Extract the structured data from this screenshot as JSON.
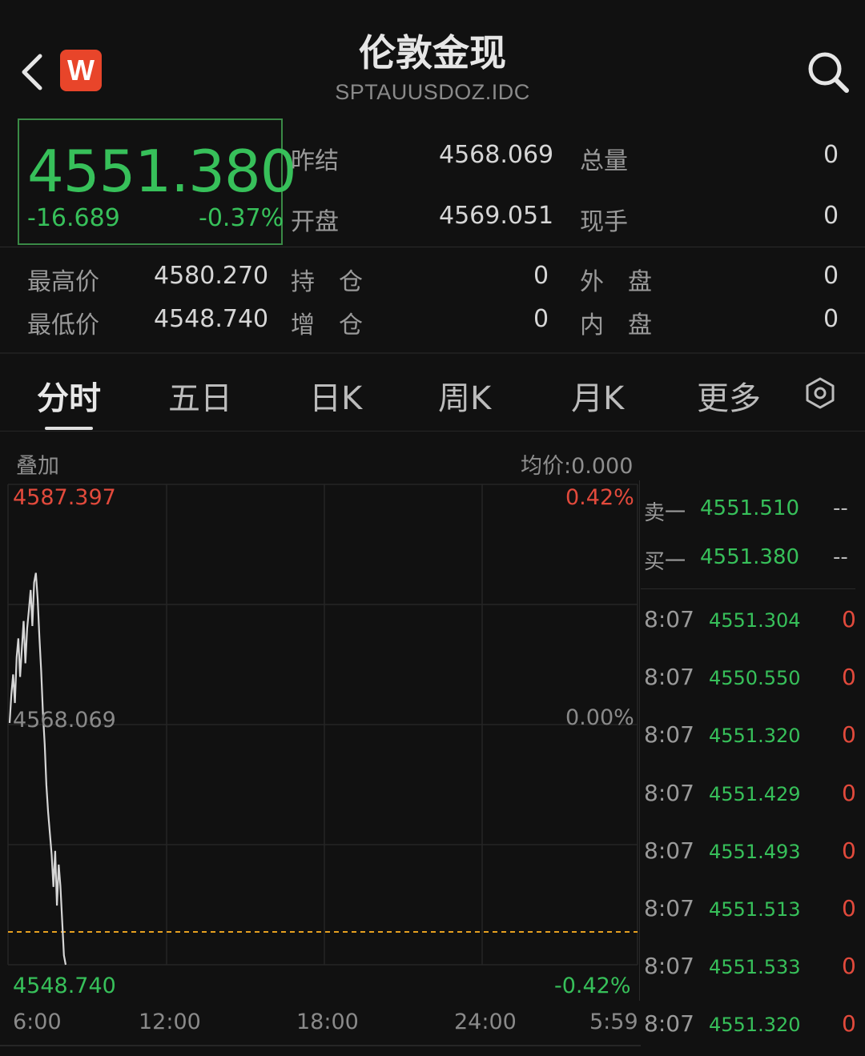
{
  "header": {
    "title": "伦敦金现",
    "code": "SPTAUUSDOZ.IDC",
    "logo_letter": "W"
  },
  "quote": {
    "price": "4551.380",
    "change": "-16.689",
    "change_pct": "-0.37%",
    "prev_settle_label": "昨结",
    "prev_settle": "4568.069",
    "open_label": "开盘",
    "open": "4569.051",
    "total_vol_label": "总量",
    "total_vol": "0",
    "cur_hand_label": "现手",
    "cur_hand": "0",
    "high_label": "最高价",
    "high": "4580.270",
    "low_label": "最低价",
    "low": "4548.740",
    "hold_label": "持　仓",
    "hold": "0",
    "add_label": "增　仓",
    "add": "0",
    "outer_label": "外　盘",
    "outer": "0",
    "inner_label": "内　盘",
    "inner": "0"
  },
  "tabs": [
    "分时",
    "五日",
    "日K",
    "周K",
    "月K",
    "更多"
  ],
  "chart_meta": {
    "overlay_label": "叠加",
    "avg_label": "均价:0.000"
  },
  "chart_data": {
    "type": "line",
    "y_top": "4587.397",
    "y_mid": "4568.069",
    "y_bottom": "4548.740",
    "pct_top": "0.42%",
    "pct_mid": "0.00%",
    "pct_bottom": "-0.42%",
    "ylim": [
      4548.74,
      4587.397
    ],
    "x_ticks": [
      "6:00",
      "12:00",
      "18:00",
      "24:00",
      "5:59"
    ],
    "prev_close": 4568.069,
    "low_marker": 4551.38,
    "series": [
      {
        "values": [
          4568.2,
          4570.5,
          4572.1,
          4569.8,
          4573.5,
          4575.0,
          4571.9,
          4574.2,
          4576.4,
          4573.0,
          4575.8,
          4577.3,
          4578.9,
          4576.0,
          4579.5,
          4580.27,
          4578.2,
          4575.1,
          4572.4,
          4569.0,
          4566.5,
          4563.2,
          4561.0,
          4559.3,
          4557.6,
          4555.0,
          4557.9,
          4553.5,
          4556.8,
          4555.1,
          4552.3,
          4549.5,
          4548.74
        ]
      }
    ],
    "points_span_minutes": 30
  },
  "orderbook": [
    {
      "label": "卖一",
      "price": "4551.510",
      "vol": "--"
    },
    {
      "label": "买一",
      "price": "4551.380",
      "vol": "--"
    }
  ],
  "trades": [
    {
      "time": "8:07",
      "price": "4551.304",
      "vol": "0"
    },
    {
      "time": "8:07",
      "price": "4550.550",
      "vol": "0"
    },
    {
      "time": "8:07",
      "price": "4551.320",
      "vol": "0"
    },
    {
      "time": "8:07",
      "price": "4551.429",
      "vol": "0"
    },
    {
      "time": "8:07",
      "price": "4551.493",
      "vol": "0"
    },
    {
      "time": "8:07",
      "price": "4551.513",
      "vol": "0"
    },
    {
      "time": "8:07",
      "price": "4551.533",
      "vol": "0"
    },
    {
      "time": "8:07",
      "price": "4551.320",
      "vol": "0"
    }
  ],
  "colors": {
    "up_red": "#e24a3c",
    "down_green": "#37c05a",
    "bg": "#111111"
  }
}
